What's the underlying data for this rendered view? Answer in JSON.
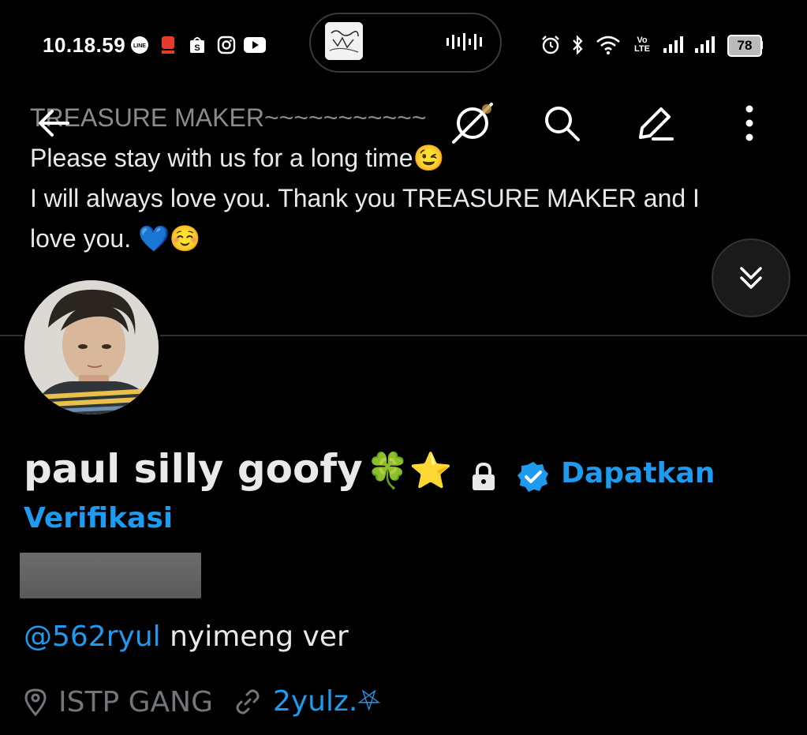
{
  "status_bar": {
    "time": "10.18.59",
    "battery": "78",
    "network_label": "Vo LTE"
  },
  "bio_text": {
    "line1": "TREASURE MAKER~~~~~~~~~~~",
    "line2": "Please stay with us for a long time",
    "line2_emoji": "😉",
    "line3": "I will always love you. Thank you TREASURE MAKER and I",
    "line4": "love you.",
    "line4_emoji": "💙☺️"
  },
  "profile": {
    "display_name": "paul silly goofy",
    "name_emojis": "🍀⭐",
    "verify_cta_1": "Dapatkan",
    "verify_cta_2": "Verifikasi",
    "bio_mention": "@562ryul",
    "bio_suffix": " nyimeng ver",
    "location": "ISTP GANG",
    "website": "2yulz.⛧"
  },
  "icons": {
    "back": "arrow-left-icon",
    "grok": "grok-icon",
    "search": "search-icon",
    "compose": "edit-icon",
    "more": "more-vertical-icon",
    "scroll_down": "chevrons-down-icon",
    "lock": "lock-icon",
    "verified": "verified-badge-icon",
    "location": "location-pin-icon",
    "link": "link-icon"
  },
  "colors": {
    "background": "#000000",
    "accent": "#1d9bf0",
    "text": "#e7e9ea",
    "muted": "#71767b"
  }
}
